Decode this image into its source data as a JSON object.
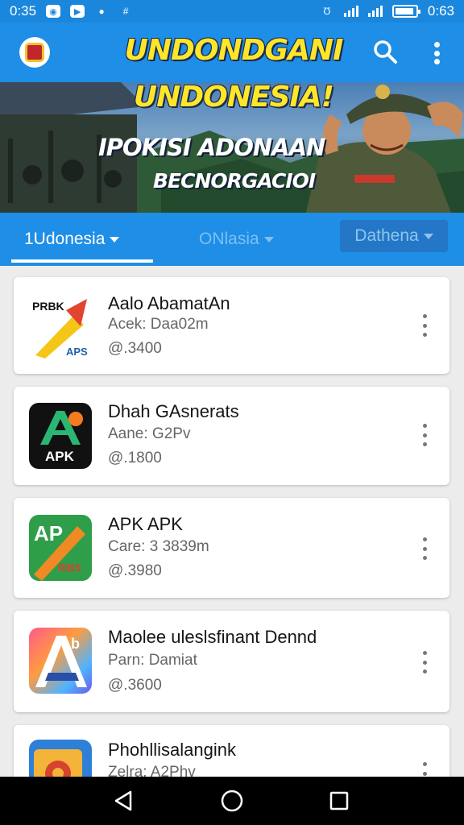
{
  "status_bar": {
    "time_left": "0:35",
    "time_right": "0:63"
  },
  "app_bar": {
    "title": "UNDONDGANI",
    "search_icon": "search-icon",
    "more_icon": "more-vert-icon"
  },
  "banner": {
    "title": "UNDONESIA!",
    "line1": "IPOKISI ADONAAN",
    "line2": "BECNORGACIOI"
  },
  "tabs": [
    {
      "label": "1Udonesia"
    },
    {
      "label": "ONlasia"
    },
    {
      "label": "Dathena"
    }
  ],
  "apps": [
    {
      "name": "Aalo AbamatAn",
      "subtitle": "Acek: Daa02m",
      "stat": "@.3400",
      "icon_label": "PRBK",
      "icon_sub": "APS"
    },
    {
      "name": "Dhah GAsnerats",
      "subtitle": "Aane: G2Pv",
      "stat": "@.1800",
      "icon_label": "APK"
    },
    {
      "name": "APK APK",
      "subtitle": "Care: 3 3839m",
      "stat": "@.3980",
      "icon_label": "AP",
      "icon_sub": "RIBS"
    },
    {
      "name": "Maolee uleslsfinant Dennd",
      "subtitle": "Parn: Damiat",
      "stat": "@.3600"
    },
    {
      "name": "Phohllisalangink",
      "subtitle": "Zelra: A2Phv"
    }
  ],
  "colors": {
    "primary": "#1e8ee6",
    "title_yellow": "#ffe629",
    "background": "#ececec"
  }
}
